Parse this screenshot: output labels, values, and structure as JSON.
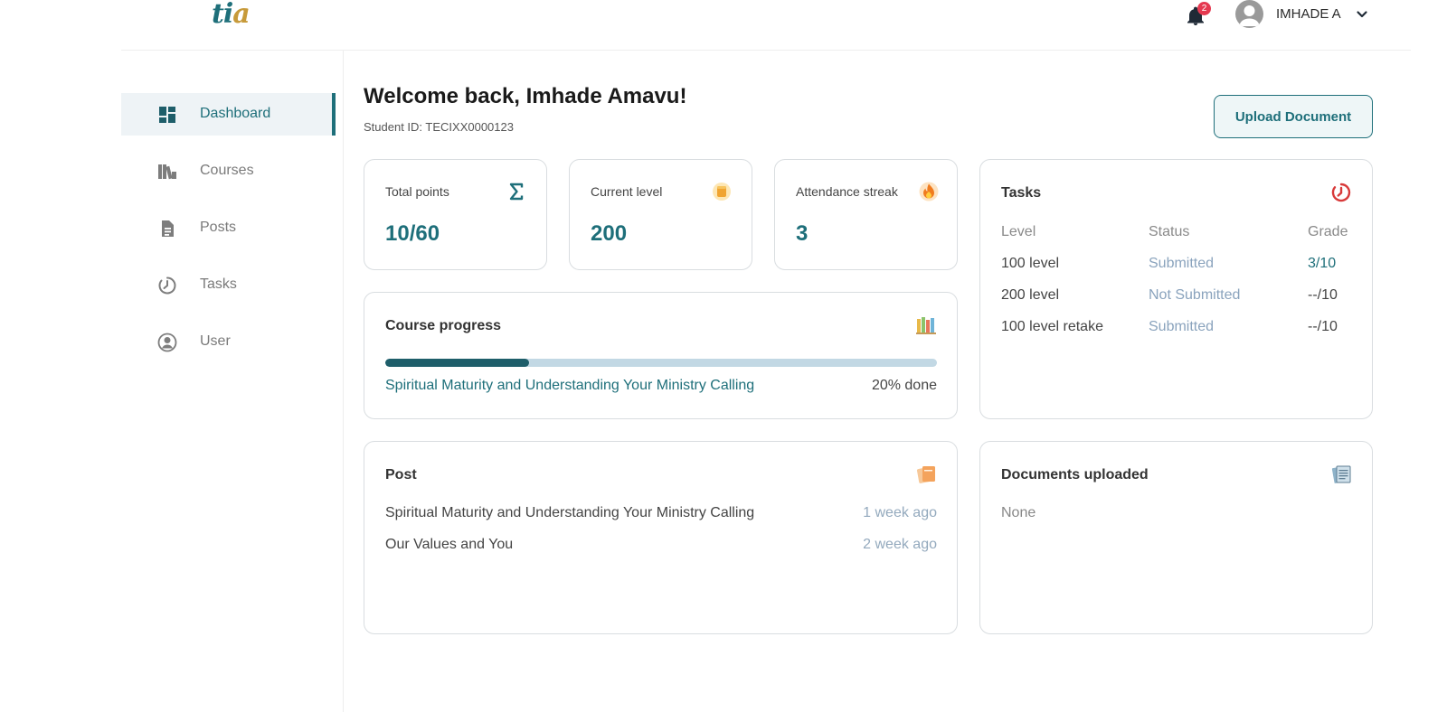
{
  "header": {
    "logo": {
      "t": "t",
      "i": "i",
      "a": "a"
    },
    "notifications_count": "2",
    "user_name": "IMHADE A"
  },
  "sidebar": {
    "items": [
      {
        "label": "Dashboard",
        "icon": "dashboard-icon",
        "active": true
      },
      {
        "label": "Courses",
        "icon": "books-icon",
        "active": false
      },
      {
        "label": "Posts",
        "icon": "document-icon",
        "active": false
      },
      {
        "label": "Tasks",
        "icon": "timer-icon",
        "active": false
      },
      {
        "label": "User",
        "icon": "user-circle-icon",
        "active": false
      }
    ]
  },
  "main": {
    "welcome": "Welcome back, Imhade Amavu!",
    "student_id": "Student ID: TECIXX0000123",
    "upload_label": "Upload Document",
    "stats": [
      {
        "label": "Total points",
        "value": "10/60",
        "icon": "sigma-icon"
      },
      {
        "label": "Current level",
        "value": "200",
        "icon": "coin-icon"
      },
      {
        "label": "Attendance streak",
        "value": "3",
        "icon": "fire-icon"
      }
    ],
    "course_progress": {
      "title": "Course progress",
      "course": "Spiritual Maturity and Understanding Your Ministry Calling",
      "done_label": "20% done",
      "progress_fraction": 0.26
    },
    "post": {
      "title": "Post",
      "items": [
        {
          "title": "Spiritual Maturity and Understanding Your Ministry Calling",
          "time": "1 week ago"
        },
        {
          "title": "Our Values and You",
          "time": "2 week ago"
        }
      ]
    },
    "tasks": {
      "title": "Tasks",
      "columns": [
        "Level",
        "Status",
        "Grade"
      ],
      "rows": [
        {
          "level": "100 level",
          "status": "Submitted",
          "grade": "3/10"
        },
        {
          "level": "200 level",
          "status": "Not Submitted",
          "grade": "--/10"
        },
        {
          "level": "100 level retake",
          "status": "Submitted",
          "grade": "--/10"
        }
      ]
    },
    "documents": {
      "title": "Documents uploaded",
      "empty_text": "None"
    }
  },
  "colors": {
    "brand": "#1e6f7a",
    "accent_gold": "#c79a3a",
    "badge_red": "#e53950",
    "status_blue": "#8aa3bd",
    "timer_red": "#d83a3a"
  }
}
